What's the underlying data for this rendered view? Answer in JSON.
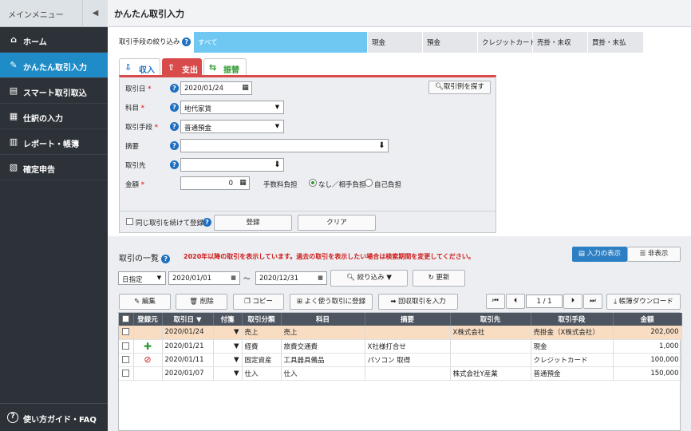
{
  "sidebar": {
    "menu_title": "メインメニュー",
    "items": [
      {
        "label": "ホーム",
        "icon": "home-icon"
      },
      {
        "label": "かんたん取引入力",
        "icon": "pencil-icon"
      },
      {
        "label": "スマート取引取込",
        "icon": "import-icon"
      },
      {
        "label": "仕訳の入力",
        "icon": "journal-icon"
      },
      {
        "label": "レポート・帳簿",
        "icon": "chart-icon"
      },
      {
        "label": "確定申告",
        "icon": "tax-icon"
      }
    ],
    "help_label": "使い方ガイド・FAQ"
  },
  "page_title": "かんたん取引入力",
  "filter": {
    "label": "取引手段の絞り込み",
    "options": [
      "すべて",
      "現金",
      "預金",
      "クレジットカード",
      "売掛・未収",
      "買掛・未払"
    ],
    "selected": "すべて"
  },
  "tabs": {
    "income": "収入",
    "expense": "支出",
    "transfer": "振替"
  },
  "form": {
    "date_label": "取引日",
    "date_value": "2020/01/24",
    "find_example": "取引例を探す",
    "account_label": "科目",
    "account_value": "地代家賃",
    "method_label": "取引手段",
    "method_value": "普通預金",
    "memo_label": "摘要",
    "partner_label": "取引先",
    "amount_label": "金額",
    "amount_value": "0",
    "fee_label": "手数料負担",
    "fee_option1": "なし／相手負担",
    "fee_option2": "自己負担",
    "repeat_label": "同じ取引を続けて登録",
    "register": "登録",
    "clear": "クリア"
  },
  "list": {
    "title": "取引の一覧",
    "notice": "2020年以降の取引を表示しています。過去の取引を表示したい場合は検索期間を変更してください。",
    "show_input": "入力の表示",
    "hide": "非表示",
    "period_type": "日指定",
    "from": "2020/01/01",
    "tilde": "〜",
    "to": "2020/12/31",
    "filter_btn": "絞り込み",
    "refresh": "更新",
    "edit": "編集",
    "delete": "削除",
    "copy": "コピー",
    "favorite": "よく使う取引に登録",
    "recurring": "回収取引を入力",
    "page": "1",
    "page_sep": "/",
    "page_total": "1",
    "download": "帳簿ダウンロード",
    "columns": [
      "登録元",
      "取引日",
      "付箋",
      "取引分類",
      "科目",
      "摘要",
      "取引先",
      "取引手段",
      "金額"
    ],
    "rows": [
      {
        "date": "2020/01/24",
        "class": "売上",
        "account": "売上",
        "memo": "",
        "partner": "X株式会社",
        "method": "売掛金（X株式会社）",
        "amount": "202,000",
        "highlight": true
      },
      {
        "date": "2020/01/21",
        "class": "経費",
        "account": "旅費交通費",
        "memo": "X社様打合せ",
        "partner": "",
        "method": "現金",
        "amount": "1,000",
        "source_icon": "plus-icon"
      },
      {
        "date": "2020/01/11",
        "class": "固定資産",
        "account": "工具器具備品",
        "memo": "パソコン 取得",
        "partner": "",
        "method": "クレジットカード",
        "amount": "100,000",
        "source_icon": "prohibited-icon"
      },
      {
        "date": "2020/01/07",
        "class": "仕入",
        "account": "仕入",
        "memo": "",
        "partner": "株式会社Y産業",
        "method": "普通預金",
        "amount": "150,000"
      }
    ]
  },
  "colors": {
    "sidebar": "#2d3238",
    "active": "#1f8cc8",
    "filter_selected": "#6ec8f2",
    "expense_tab": "#d94a4a",
    "row_highlight": "#f8ddc3"
  }
}
